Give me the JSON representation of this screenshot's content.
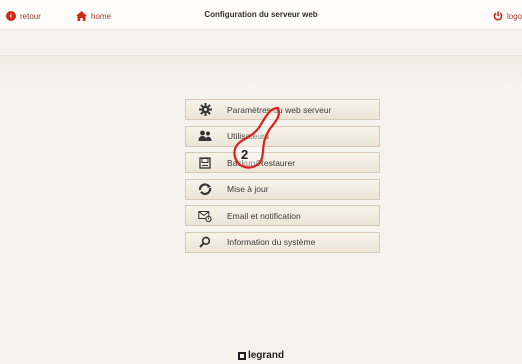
{
  "topbar": {
    "back_label": "retour",
    "home_label": "home",
    "title": "Configuration du serveur web",
    "logout_label": "logo"
  },
  "menu": {
    "items": [
      {
        "label": "Paramètres du web serveur",
        "icon": "gear-icon"
      },
      {
        "label": "Utilisateurs",
        "icon": "users-icon"
      },
      {
        "label": "Backup/Restaurer",
        "icon": "backup-icon"
      },
      {
        "label": "Mise à jour",
        "icon": "update-icon"
      },
      {
        "label": "Email et notification",
        "icon": "email-icon"
      },
      {
        "label": "Information du système",
        "icon": "search-icon"
      }
    ]
  },
  "annotation": {
    "step": "2"
  },
  "footer": {
    "brand": "legrand"
  },
  "colors": {
    "accent": "#d02a16",
    "annotation": "#d8221c",
    "background": "#f6f3ee"
  }
}
